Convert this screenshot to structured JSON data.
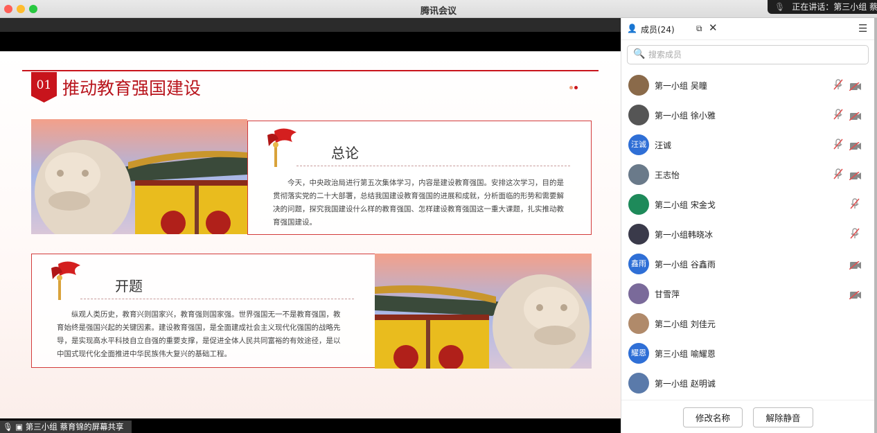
{
  "window": {
    "title": "腾讯会议"
  },
  "speaking": {
    "label": "正在讲话：第三小组 蔡"
  },
  "share": {
    "label": "第三小组 蔡育锦的屏幕共享",
    "slide": {
      "number": "01",
      "heading": "推动教育强国建设",
      "section1": {
        "title": "总论",
        "text": "今天，中央政治局进行第五次集体学习，内容是建设教育强国。安排这次学习，目的是贯彻落实党的二十大部署，总结我国建设教育强国的进展和成就，分析面临的形势和需要解决的问题，探究我国建设什么样的教育强国、怎样建设教育强国这一重大课题，扎实推动教育强国建设。"
      },
      "section2": {
        "title": "开题",
        "text": "纵观人类历史，教育兴则国家兴，教育强则国家强。世界强国无一不是教育强国，教育始终是强国兴起的关键因素。建设教育强国，是全面建成社会主义现代化强国的战略先导，是实现高水平科技自立自强的重要支撑，是促进全体人民共同富裕的有效途径，是以中国式现代化全面推进中华民族伟大复兴的基础工程。"
      }
    }
  },
  "panel": {
    "title": "成员(24)",
    "search_placeholder": "搜索成员",
    "members": [
      {
        "name": "第一小组 吴瞳",
        "avatar_text": "",
        "avatar_color": "#8a6a4a",
        "mic": "muted",
        "cam": "off"
      },
      {
        "name": "第一小组 徐小雅",
        "avatar_text": "",
        "avatar_color": "#555555",
        "mic": "muted",
        "cam": "off"
      },
      {
        "name": "汪诚",
        "avatar_text": "汪诚",
        "avatar_color": "#2f6fd6",
        "mic": "muted",
        "cam": "off"
      },
      {
        "name": "王志怡",
        "avatar_text": "",
        "avatar_color": "#6a7a8a",
        "mic": "muted",
        "cam": "off"
      },
      {
        "name": "第二小组 宋金戈",
        "avatar_text": "",
        "avatar_color": "#1e8a5a",
        "mic": "muted",
        "cam": ""
      },
      {
        "name": "第一小组韩晓冰",
        "avatar_text": "",
        "avatar_color": "#3a3a4a",
        "mic": "muted",
        "cam": ""
      },
      {
        "name": "第一小组 谷鑫雨",
        "avatar_text": "鑫雨",
        "avatar_color": "#2f6fd6",
        "mic": "",
        "cam": "off"
      },
      {
        "name": "甘雪萍",
        "avatar_text": "",
        "avatar_color": "#7a6a9a",
        "mic": "",
        "cam": "off"
      },
      {
        "name": "第二小组 刘佳元",
        "avatar_text": "",
        "avatar_color": "#b08a6a",
        "mic": "",
        "cam": ""
      },
      {
        "name": "第三小组 喻耀恩",
        "avatar_text": "耀恩",
        "avatar_color": "#2f6fd6",
        "mic": "",
        "cam": ""
      },
      {
        "name": "第一小组 赵明诚",
        "avatar_text": "",
        "avatar_color": "#5a7aaa",
        "mic": "",
        "cam": ""
      }
    ],
    "rename_button": "修改名称",
    "unmute_button": "解除静音"
  }
}
